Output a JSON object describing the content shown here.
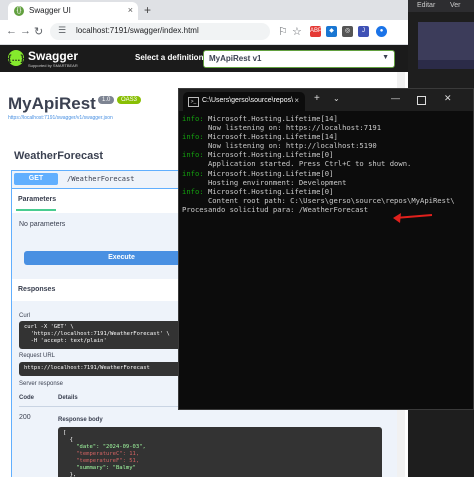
{
  "browser": {
    "tab_title": "Swagger UI",
    "url": "localhost:7191/swagger/index.html",
    "new_tab": "+",
    "back_icon": "arrow-left-icon",
    "forward_icon": "arrow-right-icon",
    "reload_icon": "reload-icon"
  },
  "swagger": {
    "brand": "Swagger",
    "brand_sub": "Supported by SMARTBEAR",
    "definition_label": "Select a definition",
    "definition_value": "MyApiRest v1",
    "api_title": "MyApiRest",
    "version_badge": "1.0",
    "oas_badge": "OAS3",
    "spec_link": "https://localhost:7191/swagger/v1/swagger.json",
    "section": "WeatherForecast",
    "operation": {
      "method": "GET",
      "path": "/WeatherForecast",
      "params_tab": "Parameters",
      "no_params": "No parameters",
      "execute": "Execute",
      "responses": "Responses",
      "curl_label": "Curl",
      "curl_lines": [
        "curl -X 'GET' \\",
        "  'https://localhost:7191/WeatherForecast' \\",
        "  -H 'accept: text/plain'"
      ],
      "request_url_label": "Request URL",
      "request_url": "https://localhost:7191/WeatherForecast",
      "server_response_label": "Server response",
      "code_header": "Code",
      "details_header": "Details",
      "status_code": "200",
      "response_body_label": "Response body",
      "body_lines": [
        "[",
        "  {",
        "    \"date\": \"2024-09-03\",",
        "    \"temperatureC\": 11,",
        "    \"temperatureF\": 51,",
        "    \"summary\": \"Balmy\"",
        "  },"
      ]
    }
  },
  "terminal": {
    "tab_title": "C:\\Users\\gerso\\source\\repos\\",
    "lines": [
      {
        "prefix": "info:",
        "text": " Microsoft.Hosting.Lifetime[14]"
      },
      {
        "prefix": "",
        "text": "      Now listening on: https://localhost:7191"
      },
      {
        "prefix": "info:",
        "text": " Microsoft.Hosting.Lifetime[14]"
      },
      {
        "prefix": "",
        "text": "      Now listening on: http://localhost:5190"
      },
      {
        "prefix": "info:",
        "text": " Microsoft.Hosting.Lifetime[0]"
      },
      {
        "prefix": "",
        "text": "      Application started. Press Ctrl+C to shut down."
      },
      {
        "prefix": "info:",
        "text": " Microsoft.Hosting.Lifetime[0]"
      },
      {
        "prefix": "",
        "text": "      Hosting environment: Development"
      },
      {
        "prefix": "info:",
        "text": " Microsoft.Hosting.Lifetime[0]"
      },
      {
        "prefix": "",
        "text": "      Content root path: C:\\Users\\gerso\\source\\repos\\MyApiRest\\"
      },
      {
        "prefix": "",
        "text": "Procesando solicitud para: /WeatherForecast"
      }
    ]
  },
  "ide": {
    "menu_1": "Editar",
    "menu_2": "Ver"
  },
  "colors": {
    "get": "#61affe",
    "execute": "#4990e2",
    "swagger_green": "#85ea2d",
    "info_green": "#13a10e",
    "annotation_red": "#e0201c"
  }
}
